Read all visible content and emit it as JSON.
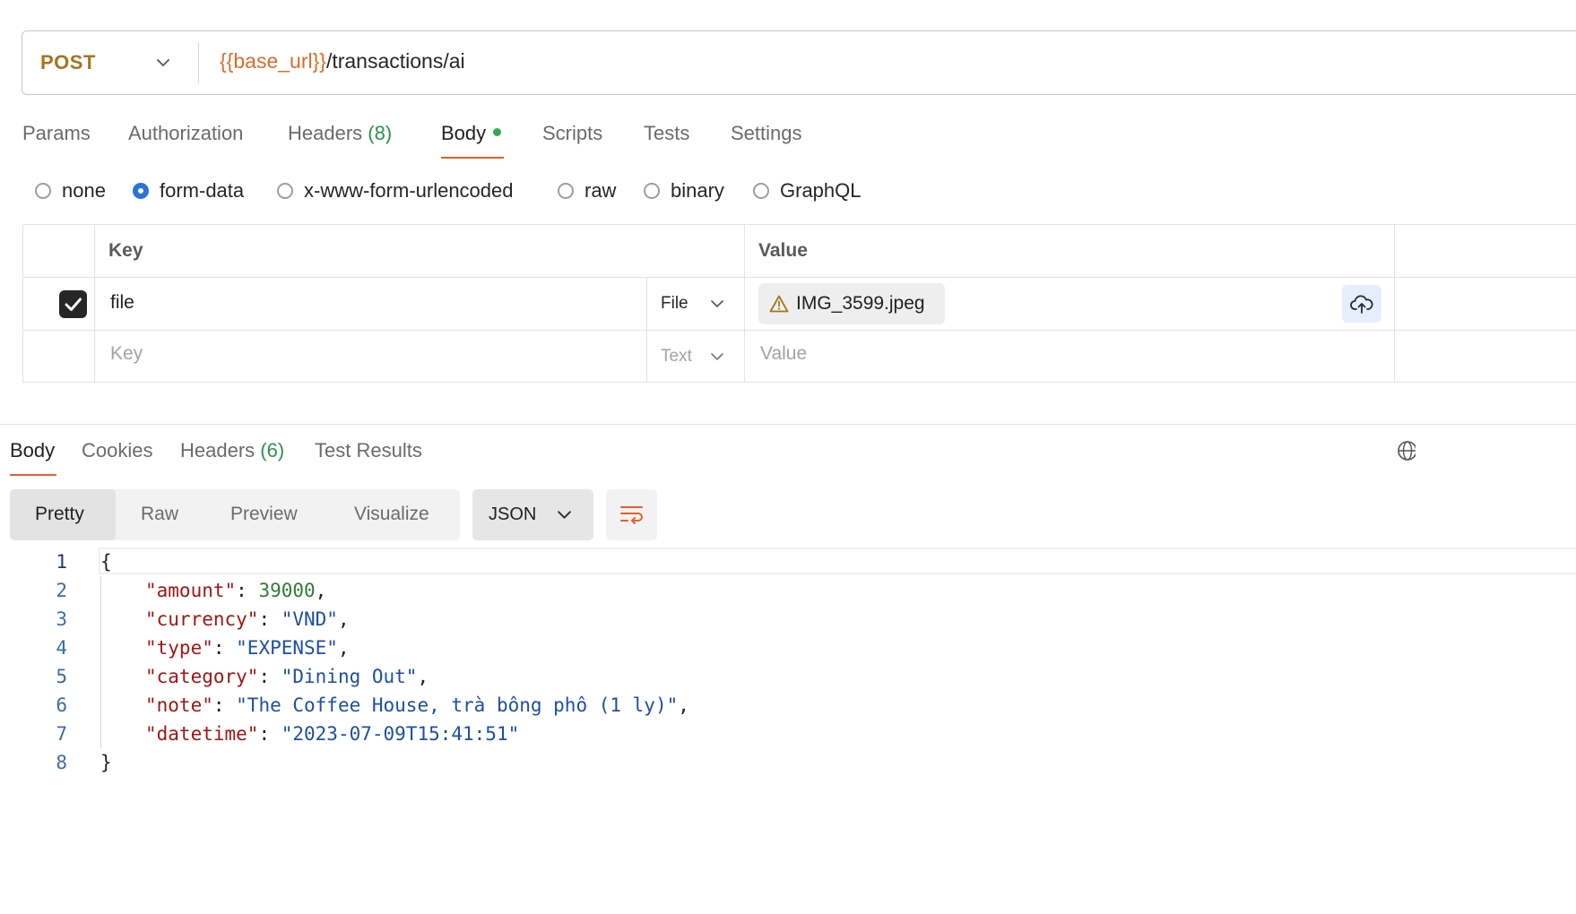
{
  "request": {
    "method": "POST",
    "url_variable": "{{base_url}}",
    "url_path": "/transactions/ai"
  },
  "request_tabs": [
    {
      "label": "Params"
    },
    {
      "label": "Authorization"
    },
    {
      "label": "Headers",
      "count": "(8)"
    },
    {
      "label": "Body"
    },
    {
      "label": "Scripts"
    },
    {
      "label": "Tests"
    },
    {
      "label": "Settings"
    }
  ],
  "body_types": [
    "none",
    "form-data",
    "x-www-form-urlencoded",
    "raw",
    "binary",
    "GraphQL"
  ],
  "selected_body_type": "form-data",
  "form_table": {
    "headers": {
      "key": "Key",
      "value": "Value"
    },
    "rows": [
      {
        "checked": true,
        "key": "file",
        "type": "File",
        "value": "IMG_3599.jpeg"
      }
    ],
    "new_row": {
      "key_placeholder": "Key",
      "type": "Text",
      "value_placeholder": "Value"
    }
  },
  "response_tabs": [
    {
      "label": "Body"
    },
    {
      "label": "Cookies"
    },
    {
      "label": "Headers",
      "count": "(6)"
    },
    {
      "label": "Test Results"
    }
  ],
  "view_modes": [
    "Pretty",
    "Raw",
    "Preview",
    "Visualize"
  ],
  "format": "JSON",
  "response_body": {
    "line_numbers": [
      "1",
      "2",
      "3",
      "4",
      "5",
      "6",
      "7",
      "8"
    ],
    "open_brace": "{",
    "close_brace": "}",
    "fields": [
      {
        "key": "\"amount\"",
        "value": "39000",
        "value_type": "number",
        "trail": ","
      },
      {
        "key": "\"currency\"",
        "value": "\"VND\"",
        "value_type": "string",
        "trail": ","
      },
      {
        "key": "\"type\"",
        "value": "\"EXPENSE\"",
        "value_type": "string",
        "trail": ","
      },
      {
        "key": "\"category\"",
        "value": "\"Dining Out\"",
        "value_type": "string",
        "trail": ","
      },
      {
        "key": "\"note\"",
        "value": "\"The Coffee House, trà bông phô (1 ly)\"",
        "value_type": "string",
        "trail": ","
      },
      {
        "key": "\"datetime\"",
        "value": "\"2023-07-09T15:41:51\"",
        "value_type": "string",
        "trail": ""
      }
    ]
  },
  "colors": {
    "method": "#a8741b",
    "url_variable": "#e06b2c",
    "accent_underline": "#e4602b",
    "count_green": "#2f8f4e",
    "radio_selected": "#2b72d9",
    "json_key": "#a31515",
    "json_string": "#1d4fa3",
    "json_number": "#2e7d32"
  },
  "icons": [
    "chevron-down-icon",
    "warning-icon",
    "cloud-upload-icon",
    "checkmark-icon",
    "globe-icon",
    "wrap-lines-icon"
  ]
}
